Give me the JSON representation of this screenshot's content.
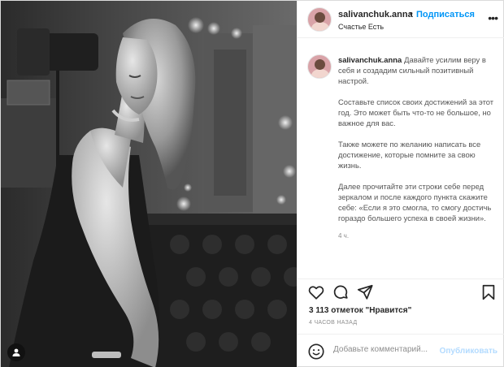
{
  "header": {
    "username": "salivanchuk.anna",
    "separator": "•",
    "follow_label": "Подписаться",
    "location": "Счастье Есть",
    "more_icon": "more-horizontal-icon"
  },
  "caption": {
    "username": "salivanchuk.anna",
    "paragraphs": [
      "Давайте усилим веру в себя и создадим сильный позитивный настрой.",
      "Составьте список своих достижений за этот год. Это может быть что-то не большое, но важное для вас.",
      "Также можете по желанию написать все достижение, которые помните за свою жизнь.",
      "Далее прочитайте эти строки себе перед зеркалом и после каждого пункта скажите себе: «Если я это смогла, то смогу достичь гораздо большего успеха в своей жизни»."
    ],
    "time": "4 ч."
  },
  "actions": {
    "icons": [
      "heart-icon",
      "comment-icon",
      "share-icon",
      "bookmark-icon"
    ]
  },
  "likes_text": "3 113 отметок \"Нравится\"",
  "posted_ago": "4 ЧАСОВ НАЗАД",
  "comment": {
    "placeholder": "Добавьте комментарий...",
    "publish_label": "Опубликовать",
    "emoji_icon": "emoji-icon"
  },
  "photo": {
    "user_tag_icon": "user-tag-icon"
  },
  "colors": {
    "accent": "#0095f6",
    "publish_disabled": "#b3dbff",
    "secondary_text": "#8e8e8e",
    "border": "#dbdbdb"
  }
}
